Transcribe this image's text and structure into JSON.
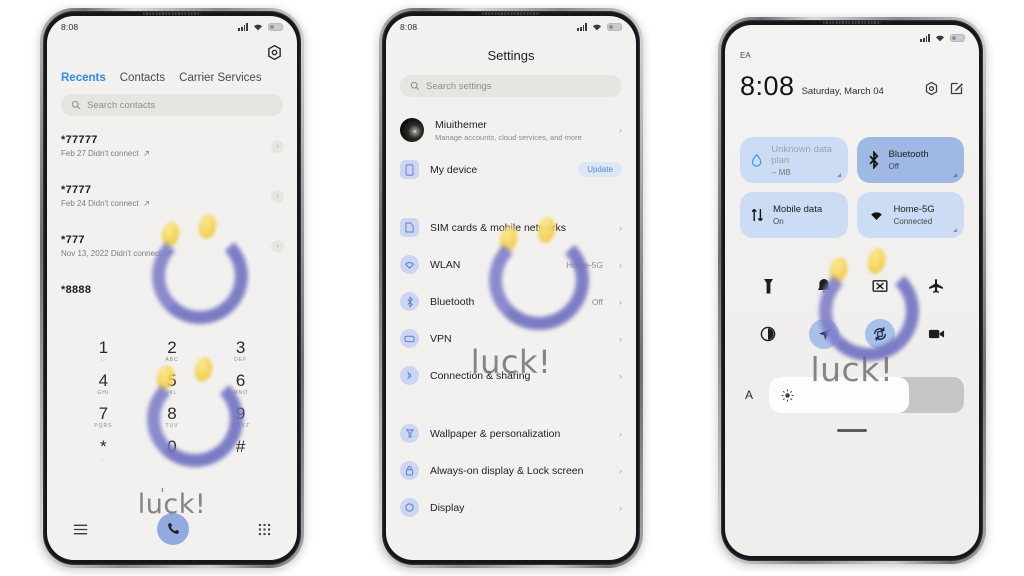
{
  "meta": {
    "watermark_text": "luck!",
    "accent_blue": "#2e8bf0",
    "smiley_eye_color": "#f5d24f",
    "smiley_mouth_color": "#6f6fc0",
    "screen_bg": "#f2f1ef"
  },
  "phone1": {
    "status": {
      "time": "8:08"
    },
    "gear_icon": "gear-icon",
    "tabs": [
      {
        "label": "Recents",
        "active": true
      },
      {
        "label": "Contacts",
        "active": false
      },
      {
        "label": "Carrier Services",
        "active": false
      }
    ],
    "search": {
      "placeholder": "Search contacts",
      "icon": "search-icon"
    },
    "calls": [
      {
        "number": "*77777",
        "detail": "Feb 27 Didn't connect"
      },
      {
        "number": "*7777",
        "detail": "Feb 24 Didn't connect"
      },
      {
        "number": "*777",
        "detail": "Nov 13, 2022 Didn't connect"
      },
      {
        "number": "*8888",
        "detail": ""
      }
    ],
    "keypad": [
      {
        "digit": "1",
        "letters": "\u0000"
      },
      {
        "digit": "2",
        "letters": "ABC"
      },
      {
        "digit": "3",
        "letters": "DEF"
      },
      {
        "digit": "4",
        "letters": "GHI"
      },
      {
        "digit": "5",
        "letters": "JKL"
      },
      {
        "digit": "6",
        "letters": "MNO"
      },
      {
        "digit": "7",
        "letters": "PQRS"
      },
      {
        "digit": "8",
        "letters": "TUV"
      },
      {
        "digit": "9",
        "letters": "WXYZ"
      },
      {
        "digit": "*",
        "letters": ","
      },
      {
        "digit": "0",
        "letters": "+"
      },
      {
        "digit": "#",
        "letters": ""
      }
    ],
    "bottom": {
      "menu_icon": "menu-icon",
      "call_icon": "phone-call-icon",
      "keypad_icon": "dialpad-icon"
    }
  },
  "phone2": {
    "status": {
      "time": "8:08"
    },
    "title": "Settings",
    "search": {
      "placeholder": "Search settings",
      "icon": "search-icon"
    },
    "account": {
      "name": "Miuithemer",
      "subtitle": "Manage accounts, cloud services, and more"
    },
    "device": {
      "label": "My device",
      "badge": "Update",
      "icon": "phone-icon"
    },
    "rows": [
      {
        "label": "SIM cards & mobile networks",
        "value": "",
        "icon": "sim-icon"
      },
      {
        "label": "WLAN",
        "value": "Home-5G",
        "icon": "wifi-icon"
      },
      {
        "label": "Bluetooth",
        "value": "Off",
        "icon": "bluetooth-icon"
      },
      {
        "label": "VPN",
        "value": "",
        "icon": "vpn-icon"
      },
      {
        "label": "Connection & sharing",
        "value": "",
        "icon": "sharing-icon"
      }
    ],
    "rows2": [
      {
        "label": "Wallpaper & personalization",
        "value": "",
        "icon": "wallpaper-icon"
      },
      {
        "label": "Always-on display & Lock screen",
        "value": "",
        "icon": "lock-icon"
      },
      {
        "label": "Display",
        "value": "",
        "icon": "display-icon"
      }
    ]
  },
  "phone3": {
    "carrier": "EA",
    "clock": "8:08",
    "date": "Saturday, March 04",
    "header_icons": {
      "settings": "gear-icon",
      "edit": "edit-icon"
    },
    "tiles": [
      {
        "title": "Unknown data plan",
        "sub": "-- MB",
        "icon": "data-drop-icon",
        "on": false
      },
      {
        "title": "Bluetooth",
        "sub": "Off",
        "icon": "bluetooth-icon",
        "on": true
      },
      {
        "title": "Mobile data",
        "sub": "On",
        "icon": "mobile-data-icon",
        "on": false
      },
      {
        "title": "Home-5G",
        "sub": "Connected",
        "icon": "wifi-icon",
        "on": false
      }
    ],
    "toggles": [
      {
        "name": "flashlight-icon",
        "active": false
      },
      {
        "name": "bell-icon",
        "active": false
      },
      {
        "name": "screenshot-icon",
        "active": false
      },
      {
        "name": "airplane-icon",
        "active": false
      },
      {
        "name": "dark-mode-icon",
        "active": false
      },
      {
        "name": "location-icon",
        "active": true
      },
      {
        "name": "auto-rotate-icon",
        "active": true
      },
      {
        "name": "screen-record-icon",
        "active": false
      }
    ],
    "brightness": {
      "auto_label": "A",
      "icon": "sun-icon",
      "level": 72
    }
  }
}
